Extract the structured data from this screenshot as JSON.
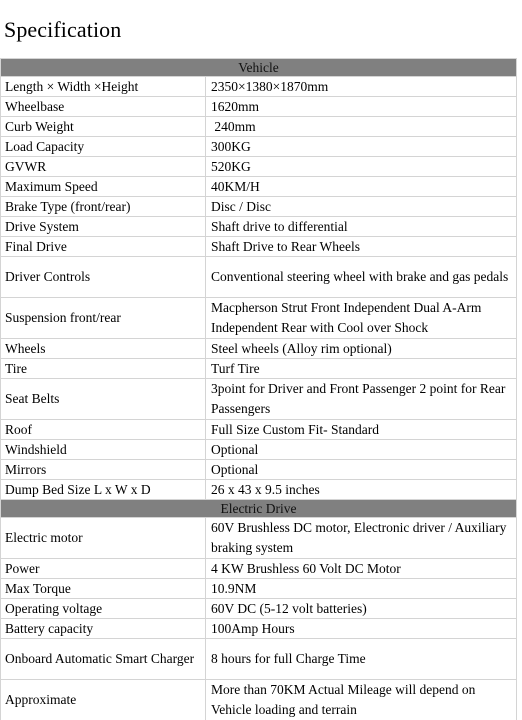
{
  "page": {
    "title": "Specification"
  },
  "table": {
    "sections": [
      {
        "header": "Vehicle",
        "rows": [
          {
            "label": "Length × Width ×Height",
            "value": "2350×1380×1870mm",
            "lines": 1
          },
          {
            "label": "Wheelbase",
            "value": "1620mm",
            "lines": 1
          },
          {
            "label": "Curb Weight",
            "value": " 240mm",
            "lines": 1
          },
          {
            "label": "Load Capacity",
            "value": "300KG",
            "lines": 1
          },
          {
            "label": "GVWR",
            "value": "520KG",
            "lines": 1
          },
          {
            "label": "Maximum Speed",
            "value": "40KM/H",
            "lines": 1
          },
          {
            "label": "Brake Type (front/rear)",
            "value": "Disc / Disc",
            "lines": 1
          },
          {
            "label": "Drive System",
            "value": "Shaft drive to differential",
            "lines": 1
          },
          {
            "label": "Final Drive",
            "value": "Shaft Drive to Rear Wheels",
            "lines": 1
          },
          {
            "label": "Driver Controls",
            "value": "Conventional steering wheel with brake and gas pedals",
            "lines": 2
          },
          {
            "label": "Suspension front/rear",
            "value": "Macpherson Strut Front Independent Dual A-Arm Independent Rear with Cool over Shock",
            "lines": 2
          },
          {
            "label": "Wheels",
            "value": "Steel wheels (Alloy rim optional)",
            "lines": 1
          },
          {
            "label": "Tire",
            "value": "Turf Tire",
            "lines": 1
          },
          {
            "label": "Seat Belts",
            "value": "3point for Driver and Front Passenger 2 point for Rear Passengers",
            "lines": 2
          },
          {
            "label": "Roof",
            "value": "Full Size Custom Fit- Standard",
            "lines": 1
          },
          {
            "label": "Windshield",
            "value": "Optional",
            "lines": 1
          },
          {
            "label": "Mirrors",
            "value": "Optional",
            "lines": 1
          },
          {
            "label": "Dump Bed Size L x W x D",
            "value": "26 x 43 x 9.5 inches",
            "lines": 1
          }
        ]
      },
      {
        "header": "Electric Drive",
        "rows": [
          {
            "label": "Electric motor",
            "value": "60V Brushless DC motor, Electronic driver / Auxiliary braking system",
            "lines": 2
          },
          {
            "label": "Power",
            "value": "4 KW Brushless 60 Volt DC Motor",
            "lines": 1
          },
          {
            "label": "Max Torque",
            "value": "10.9NM",
            "lines": 1
          },
          {
            "label": "Operating voltage",
            "value": "60V DC (5-12 volt batteries)",
            "lines": 1
          },
          {
            "label": "Battery capacity",
            "value": "100Amp Hours",
            "lines": 1
          },
          {
            "label": "Onboard Automatic Smart Charger",
            "value": "8 hours for full Charge Time",
            "lines": 2
          },
          {
            "label": "Approximate",
            "value": "More than 70KM Actual Mileage will depend on Vehicle loading and terrain",
            "lines": 2
          }
        ]
      }
    ]
  },
  "colors": {
    "section_header_background": "#808080",
    "border": "#d4d4d4",
    "page_background": "#ffffff",
    "text": "#000000"
  }
}
